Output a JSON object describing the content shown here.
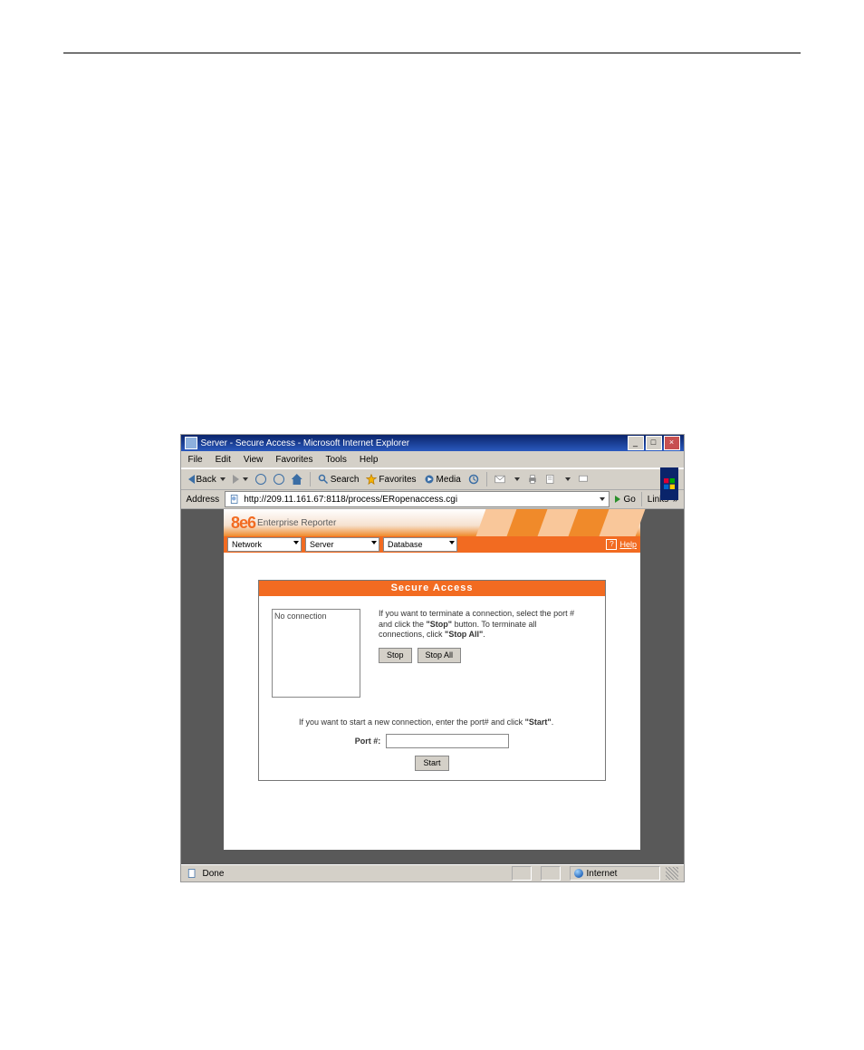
{
  "window": {
    "title": "Server - Secure Access - Microsoft Internet Explorer",
    "menus": [
      "File",
      "Edit",
      "View",
      "Favorites",
      "Tools",
      "Help"
    ],
    "toolbar": {
      "back": "Back",
      "search": "Search",
      "favorites": "Favorites",
      "media": "Media"
    },
    "address_label": "Address",
    "url": "http://209.11.161.67:8118/process/ERopenaccess.cgi",
    "go": "Go",
    "links": "Links"
  },
  "brand": {
    "logo": "8e6",
    "product": "Enterprise Reporter"
  },
  "nav": {
    "network": "Network",
    "server": "Server",
    "database": "Database",
    "help": "Help"
  },
  "panel": {
    "title": "Secure Access",
    "connection_list": "No connection",
    "terminate_hint_1": "If you want to terminate a connection, select the port #",
    "terminate_hint_2": "and click the ",
    "terminate_hint_2b": "\"Stop\"",
    "terminate_hint_2c": " button. To terminate all",
    "terminate_hint_3a": "connections, click ",
    "terminate_hint_3b": "\"Stop All\"",
    "terminate_hint_3c": ".",
    "btn_stop": "Stop",
    "btn_stopall": "Stop All",
    "start_hint_a": "If you want to start a new connection, enter the port# and click ",
    "start_hint_b": "\"Start\"",
    "start_hint_c": ".",
    "port_label": "Port #:",
    "btn_start": "Start"
  },
  "status": {
    "done": "Done",
    "zone": "Internet"
  }
}
